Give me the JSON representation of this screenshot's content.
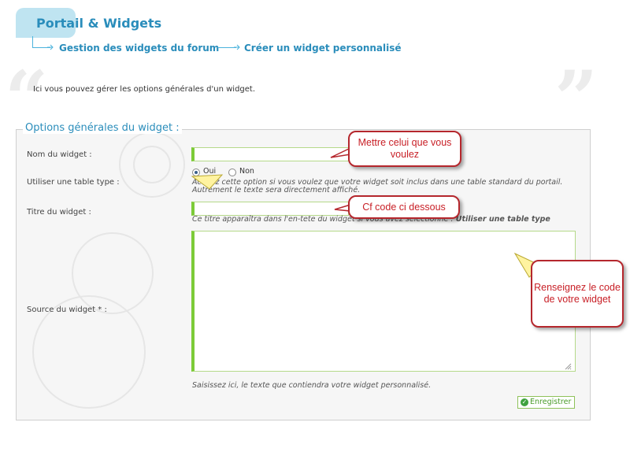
{
  "header": {
    "title": "Portail & Widgets",
    "breadcrumb": [
      "Gestion des widgets du forum",
      "Créer un widget personnalisé"
    ]
  },
  "intro": "Ici vous pouvez gérer les options générales d'un widget.",
  "quotes": {
    "open": "“",
    "close": "”"
  },
  "panel": {
    "legend": "Options générales du widget :",
    "fields": {
      "name": {
        "label": "Nom du widget :",
        "value": ""
      },
      "use_table": {
        "label": "Utiliser une table type :",
        "options": [
          "Oui",
          "Non"
        ],
        "selected": "Oui",
        "help_1": "Activez cette option si vous voulez que votre widget soit inclus dans une table standard du portail.",
        "help_2": "Autrement le texte sera directement affiché."
      },
      "title": {
        "label": "Titre du widget :",
        "value": "",
        "help": "Ce titre apparaîtra dans l'en-tete du widget si vous avez sélectionné :",
        "help_bold": "Utiliser une table type"
      },
      "source": {
        "label": "Source du widget * :",
        "value": "",
        "help": "Saisissez ici, le texte que contiendra votre widget personnalisé."
      }
    },
    "save_label": "Enregistrer"
  },
  "callouts": {
    "c1": "Mettre celui que vous voulez",
    "c2": "Cf code ci dessous",
    "c3": "Renseignez le code de votre widget"
  },
  "colors": {
    "accent": "#2a8dbb",
    "field_border": "#7ccb38",
    "callout_border": "#b5272d",
    "callout_text": "#c81f26"
  },
  "icons": {
    "open_quote": "quote-open-icon",
    "close_quote": "quote-close-icon",
    "save": "check-circle-icon",
    "resize": "resize-grip-icon"
  }
}
